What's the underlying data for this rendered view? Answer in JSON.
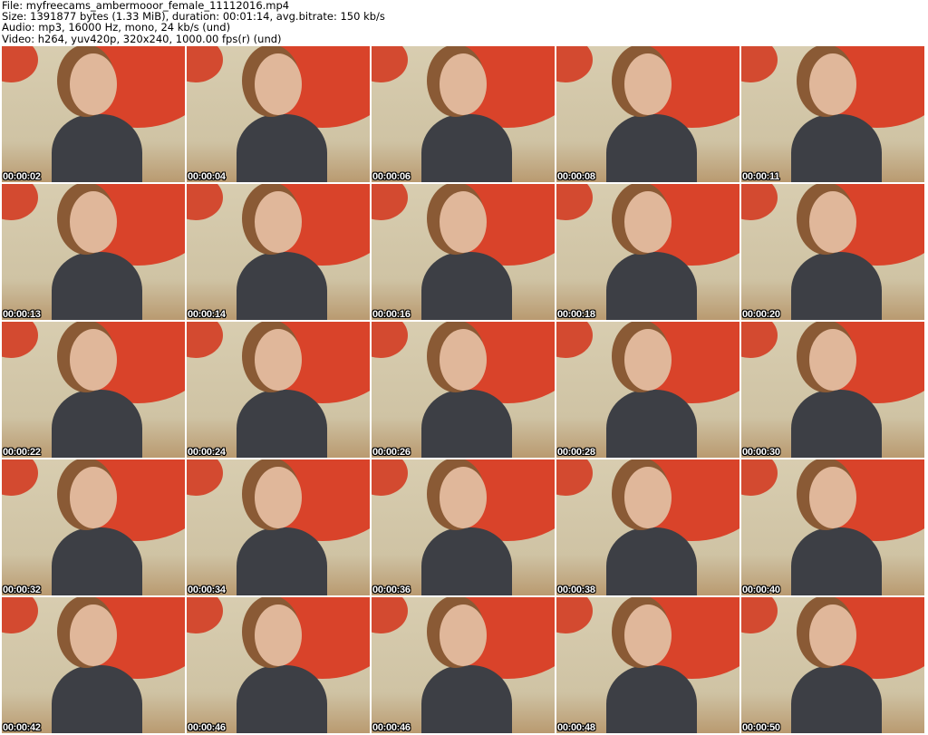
{
  "header": {
    "file": "File: myfreecams_ambermooor_female_11112016.mp4",
    "size": "Size: 1391877 bytes (1.33 MiB), duration: 00:01:14, avg.bitrate: 150 kb/s",
    "audio": "Audio: mp3, 16000 Hz, mono, 24 kb/s (und)",
    "video": "Video: h264, yuv420p, 320x240, 1000.00 fps(r) (und)"
  },
  "timestamps": [
    "00:00:02",
    "00:00:04",
    "00:00:06",
    "00:00:08",
    "00:00:11",
    "00:00:13",
    "00:00:14",
    "00:00:16",
    "00:00:18",
    "00:00:20",
    "00:00:22",
    "00:00:24",
    "00:00:26",
    "00:00:28",
    "00:00:30",
    "00:00:32",
    "00:00:34",
    "00:00:36",
    "00:00:38",
    "00:00:40",
    "00:00:42",
    "00:00:46",
    "00:00:46",
    "00:00:48",
    "00:00:50"
  ]
}
